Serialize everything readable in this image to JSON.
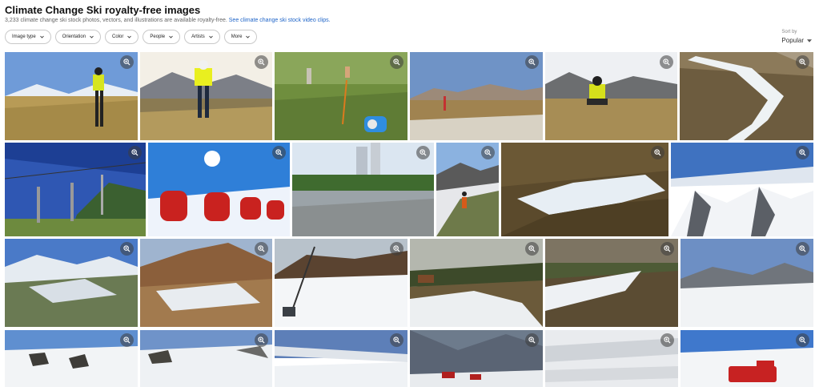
{
  "page": {
    "title": "Climate Change Ski royalty-free images",
    "subtitle_count_text": "3,233 climate change ski stock photos, vectors, and illustrations are available royalty-free.",
    "subtitle_link": "See climate change ski stock video clips."
  },
  "filters": [
    {
      "label": "Image type"
    },
    {
      "label": "Orientation"
    },
    {
      "label": "Color"
    },
    {
      "label": "People"
    },
    {
      "label": "Artists"
    },
    {
      "label": "More"
    }
  ],
  "sort": {
    "label": "Sort by",
    "value": "Popular"
  },
  "icons": {
    "zoom": "zoom-in-icon",
    "chevron": "chevron-down-icon"
  },
  "colors": {
    "link": "#1e64c8",
    "chip_border": "#c9c9c9"
  }
}
